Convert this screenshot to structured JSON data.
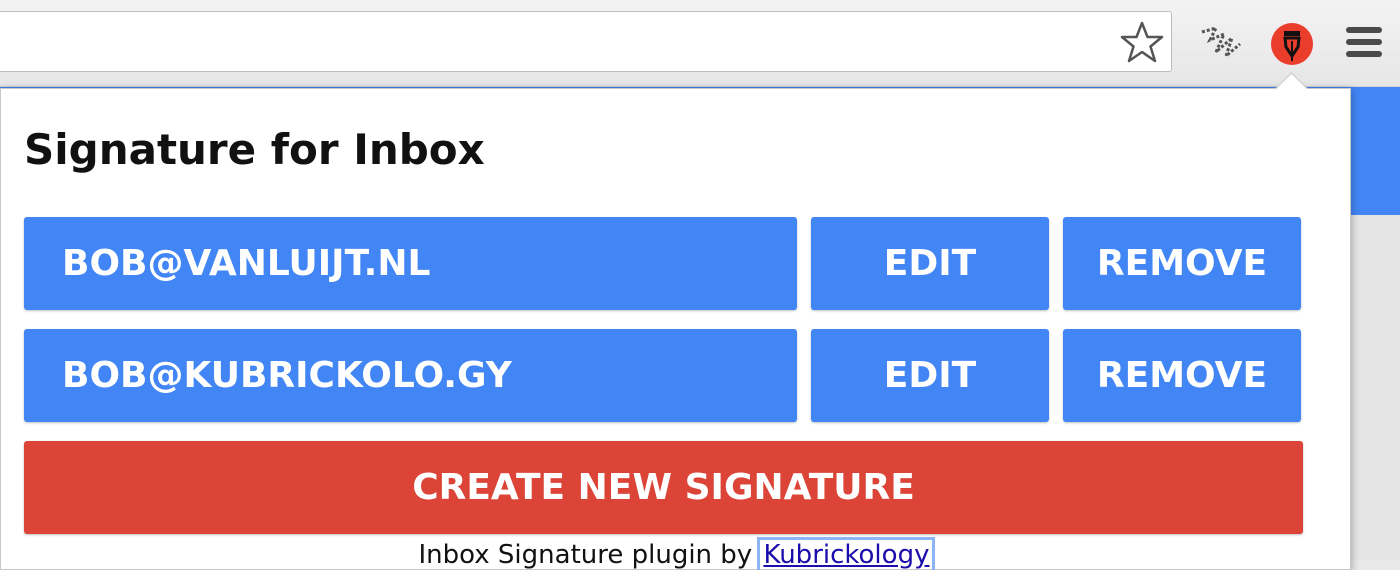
{
  "browser": {
    "star_icon": "star-icon",
    "extension_icons": [
      "scribble-extension-icon",
      "pen-nib-extension-icon"
    ],
    "menu_icon": "hamburger-menu-icon"
  },
  "popup": {
    "title": "Signature for Inbox",
    "signatures": [
      {
        "email": "BOB@VANLUIJT.NL",
        "edit_label": "EDIT",
        "remove_label": "REMOVE"
      },
      {
        "email": "BOB@KUBRICKOLO.GY",
        "edit_label": "EDIT",
        "remove_label": "REMOVE"
      }
    ],
    "create_label": "CREATE NEW SIGNATURE",
    "footer_text": "Inbox Signature plugin by ",
    "footer_link": "Kubrickology"
  },
  "colors": {
    "button_blue": "#4285f4",
    "button_red": "#db4437",
    "extension_red": "#ea3d2b"
  }
}
